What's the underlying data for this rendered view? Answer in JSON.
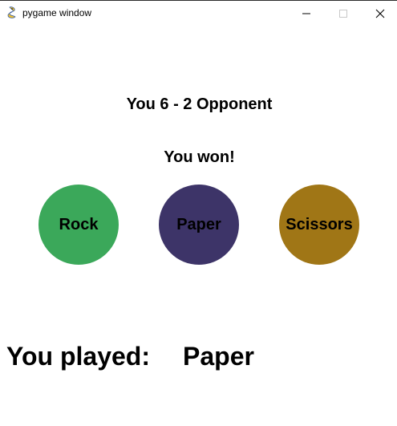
{
  "window": {
    "title": "pygame window",
    "icon": "pygame-snake-icon"
  },
  "game": {
    "score_text": "You 6 - 2 Opponent",
    "result_text": "You won!",
    "choices": [
      {
        "label": "Rock",
        "color": "#3ba85a"
      },
      {
        "label": "Paper",
        "color": "#3d3468"
      },
      {
        "label": "Scissors",
        "color": "#a07616"
      }
    ],
    "played_label": "You played:",
    "played_value": "Paper"
  }
}
